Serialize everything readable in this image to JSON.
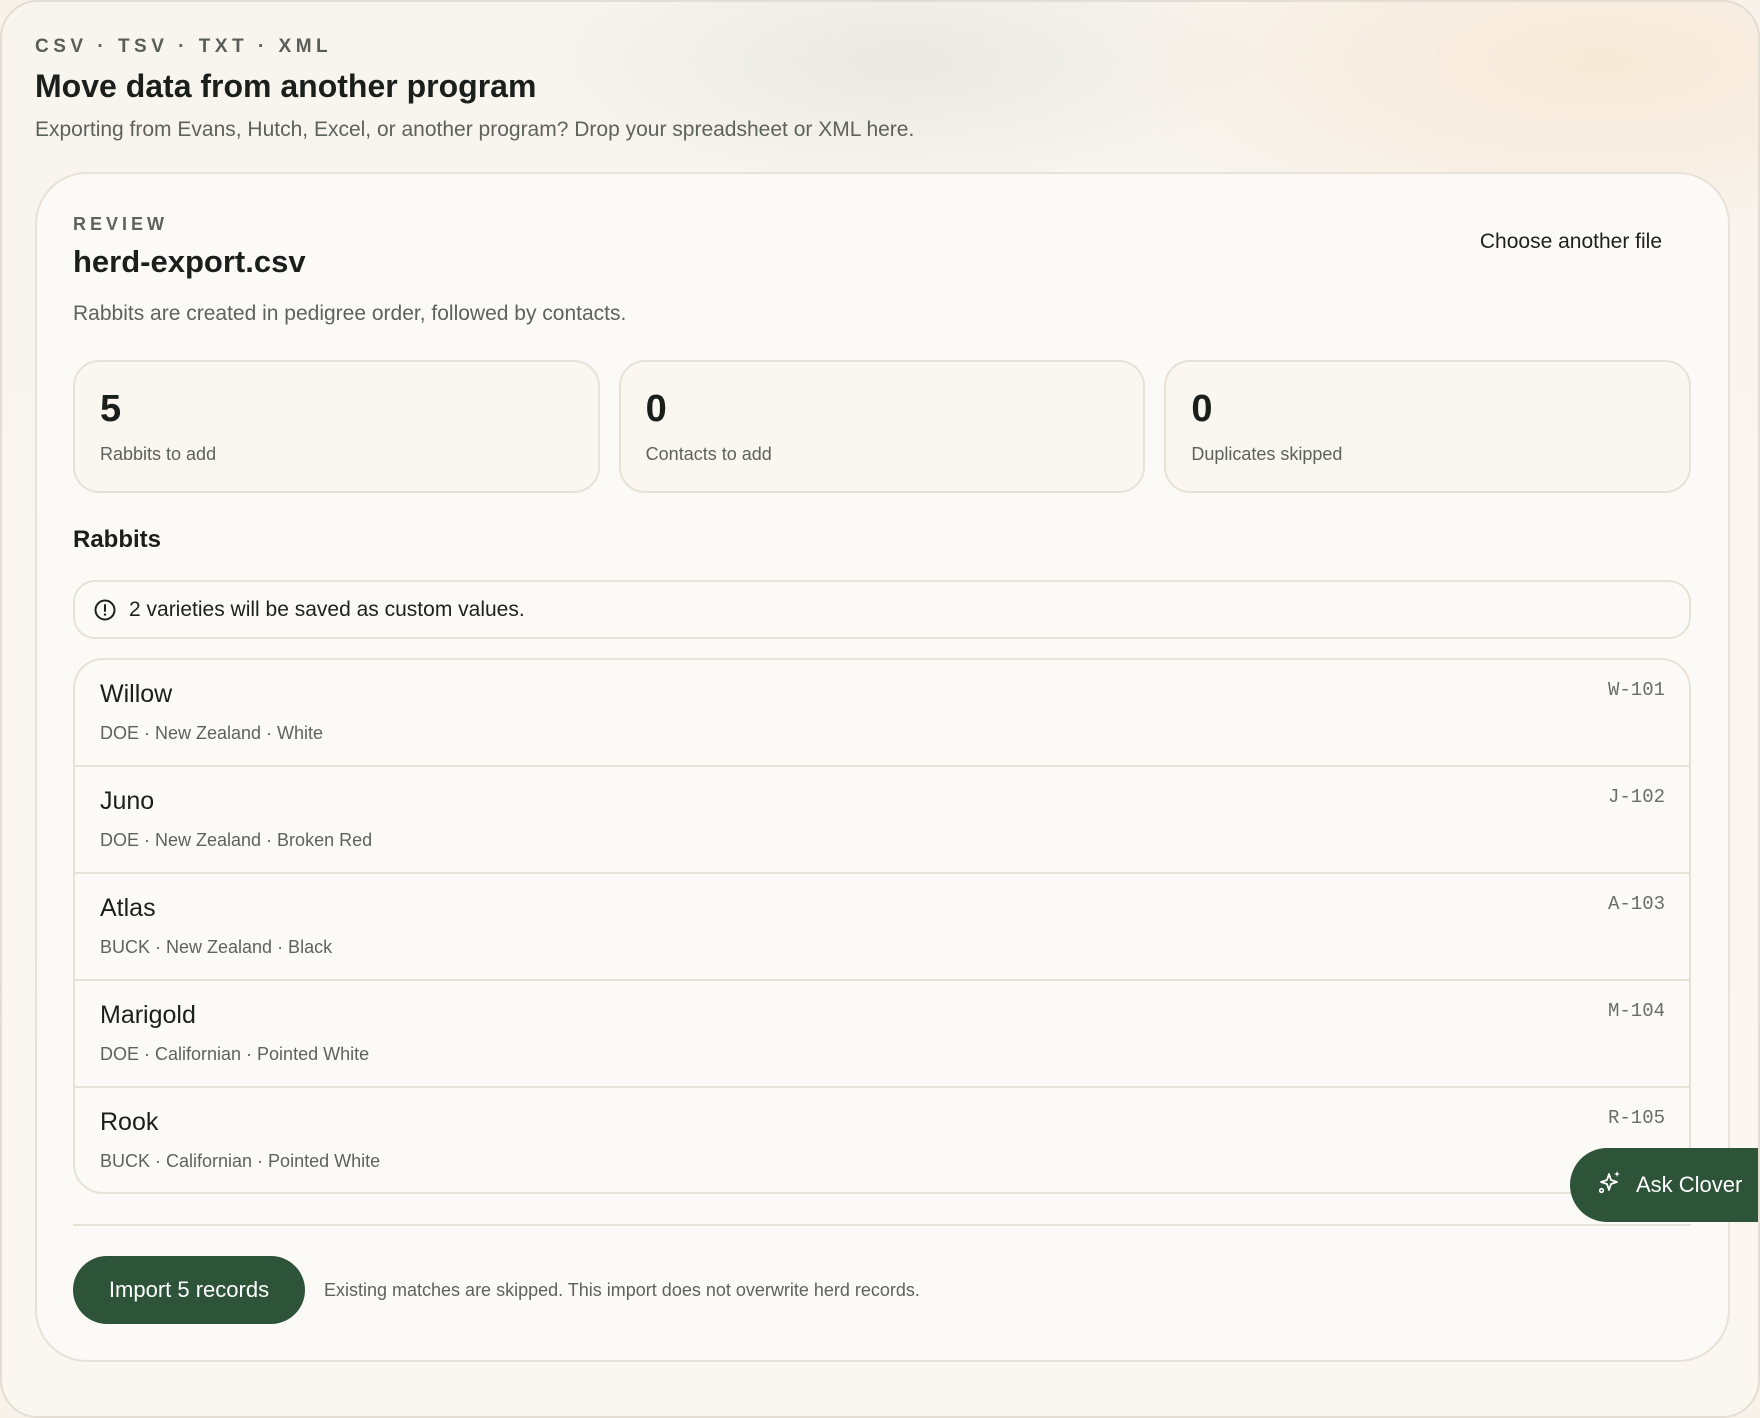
{
  "header": {
    "eyebrow": "CSV · TSV · TXT · XML",
    "title": "Move data from another program",
    "subtitle": "Exporting from Evans, Hutch, Excel, or another program? Drop your spreadsheet or XML here."
  },
  "review": {
    "eyebrow": "REVIEW",
    "file_name": "herd-export.csv",
    "choose_label": "Choose another file",
    "description": "Rabbits are created in pedigree order, followed by contacts."
  },
  "stats": [
    {
      "value": "5",
      "label": "Rabbits to add"
    },
    {
      "value": "0",
      "label": "Contacts to add"
    },
    {
      "value": "0",
      "label": "Duplicates skipped"
    }
  ],
  "rabbits": {
    "title": "Rabbits",
    "notice": "2 varieties will be saved as custom values.",
    "notice_icon": "info-circle-icon",
    "items": [
      {
        "name": "Willow",
        "meta": "DOE · New Zealand · White",
        "id": "W-101"
      },
      {
        "name": "Juno",
        "meta": "DOE · New Zealand · Broken Red",
        "id": "J-102"
      },
      {
        "name": "Atlas",
        "meta": "BUCK · New Zealand · Black",
        "id": "A-103"
      },
      {
        "name": "Marigold",
        "meta": "DOE · Californian · Pointed White",
        "id": "M-104"
      },
      {
        "name": "Rook",
        "meta": "BUCK · Californian · Pointed White",
        "id": "R-105"
      }
    ]
  },
  "footer": {
    "import_label": "Import 5 records",
    "note": "Existing matches are skipped. This import does not overwrite herd records."
  },
  "assistant": {
    "label": "Ask Clover",
    "icon": "sparkle-icon"
  },
  "colors": {
    "accent": "#2d5438",
    "background": "#f7f2ea",
    "card": "#fcfaf6",
    "border": "#e7e1d8"
  }
}
